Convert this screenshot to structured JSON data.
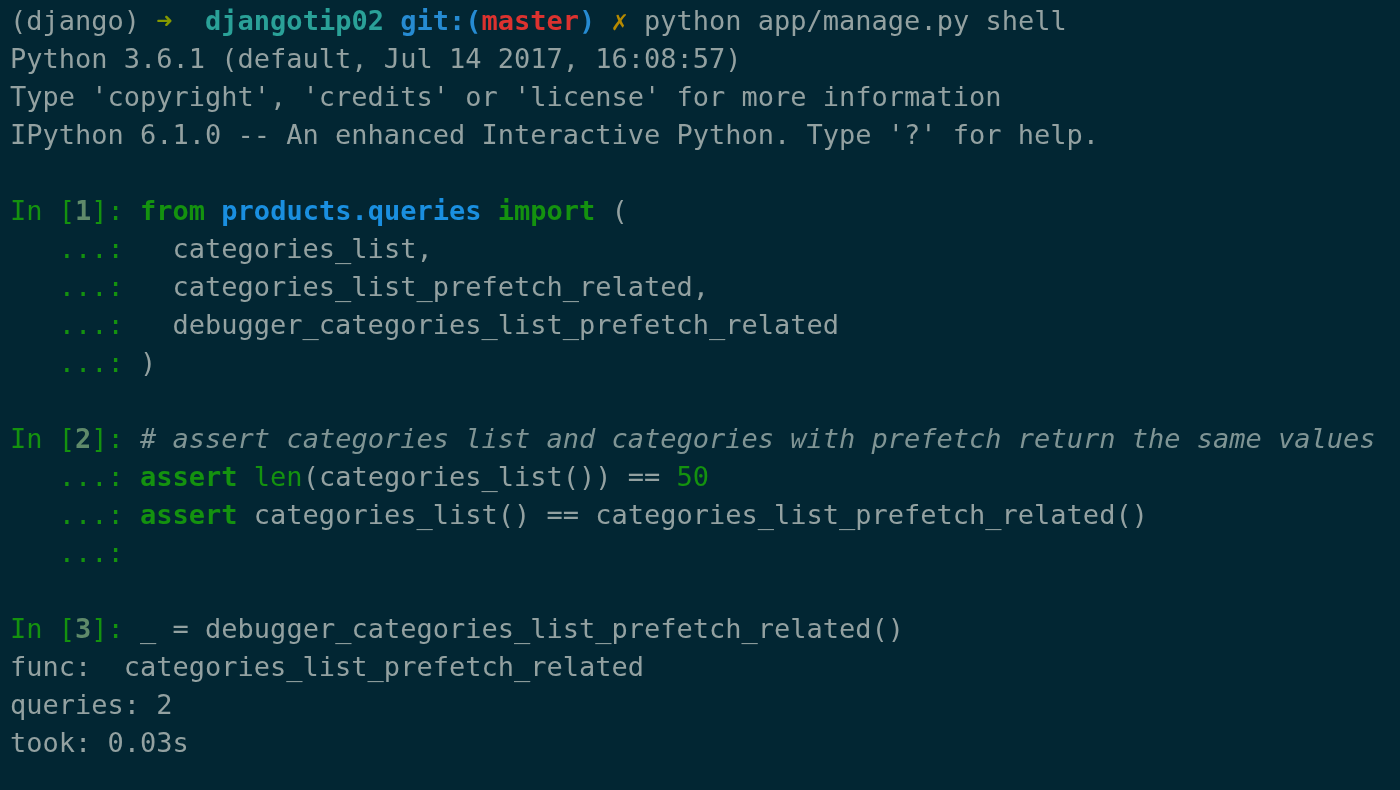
{
  "terminal": {
    "lines": [
      {
        "kind": "text",
        "segments": [
          {
            "kind": "plain",
            "text": "(django) "
          },
          {
            "kind": "arrow",
            "text": "➜  "
          },
          {
            "kind": "dir",
            "text": "djangotip02 "
          },
          {
            "kind": "git",
            "text": "git:("
          },
          {
            "kind": "branch",
            "text": "master"
          },
          {
            "kind": "git",
            "text": ") "
          },
          {
            "kind": "dirty",
            "text": "✗"
          },
          {
            "kind": "plain",
            "text": " python app/manage.py shell"
          }
        ]
      },
      {
        "kind": "text",
        "segments": [
          {
            "kind": "plain",
            "text": "Python 3.6.1 (default, Jul 14 2017, 16:08:57)"
          }
        ]
      },
      {
        "kind": "text",
        "segments": [
          {
            "kind": "plain",
            "text": "Type 'copyright', 'credits' or 'license' for more information"
          }
        ]
      },
      {
        "kind": "text",
        "segments": [
          {
            "kind": "plain",
            "text": "IPython 6.1.0 -- An enhanced Interactive Python. Type '?' for help."
          }
        ]
      },
      {
        "kind": "blank"
      },
      {
        "kind": "text",
        "segments": [
          {
            "kind": "prompt",
            "text": "In ["
          },
          {
            "kind": "prompt-num",
            "text": "1"
          },
          {
            "kind": "prompt",
            "text": "]: "
          },
          {
            "kind": "keyword",
            "text": "from "
          },
          {
            "kind": "module",
            "text": "products.queries "
          },
          {
            "kind": "keyword",
            "text": "import"
          },
          {
            "kind": "plain",
            "text": " ("
          }
        ]
      },
      {
        "kind": "text",
        "segments": [
          {
            "kind": "continuation",
            "text": "   ...: "
          },
          {
            "kind": "plain",
            "text": "  categories_list,"
          }
        ]
      },
      {
        "kind": "text",
        "segments": [
          {
            "kind": "continuation",
            "text": "   ...: "
          },
          {
            "kind": "plain",
            "text": "  categories_list_prefetch_related,"
          }
        ]
      },
      {
        "kind": "text",
        "segments": [
          {
            "kind": "continuation",
            "text": "   ...: "
          },
          {
            "kind": "plain",
            "text": "  debugger_categories_list_prefetch_related"
          }
        ]
      },
      {
        "kind": "text",
        "segments": [
          {
            "kind": "continuation",
            "text": "   ...: "
          },
          {
            "kind": "plain",
            "text": ")"
          }
        ]
      },
      {
        "kind": "blank"
      },
      {
        "kind": "text",
        "segments": [
          {
            "kind": "prompt",
            "text": "In ["
          },
          {
            "kind": "prompt-num",
            "text": "2"
          },
          {
            "kind": "prompt",
            "text": "]: "
          },
          {
            "kind": "comment",
            "text": "# assert categories list and categories with prefetch return the same values"
          }
        ]
      },
      {
        "kind": "text",
        "segments": [
          {
            "kind": "continuation",
            "text": "   ...: "
          },
          {
            "kind": "keyword",
            "text": "assert "
          },
          {
            "kind": "builtin",
            "text": "len"
          },
          {
            "kind": "plain",
            "text": "(categories_list()) == "
          },
          {
            "kind": "number",
            "text": "50"
          }
        ]
      },
      {
        "kind": "text",
        "segments": [
          {
            "kind": "continuation",
            "text": "   ...: "
          },
          {
            "kind": "keyword",
            "text": "assert"
          },
          {
            "kind": "plain",
            "text": " categories_list() == categories_list_prefetch_related()"
          }
        ]
      },
      {
        "kind": "text",
        "segments": [
          {
            "kind": "continuation",
            "text": "   ...:"
          }
        ]
      },
      {
        "kind": "blank"
      },
      {
        "kind": "text",
        "segments": [
          {
            "kind": "prompt",
            "text": "In ["
          },
          {
            "kind": "prompt-num",
            "text": "3"
          },
          {
            "kind": "prompt",
            "text": "]: "
          },
          {
            "kind": "plain",
            "text": "_ = debugger_categories_list_prefetch_related()"
          }
        ]
      },
      {
        "kind": "text",
        "segments": [
          {
            "kind": "plain",
            "text": "func:  categories_list_prefetch_related"
          }
        ]
      },
      {
        "kind": "text",
        "segments": [
          {
            "kind": "plain",
            "text": "queries: 2"
          }
        ]
      },
      {
        "kind": "text",
        "segments": [
          {
            "kind": "plain",
            "text": "took: 0.03s"
          }
        ]
      }
    ]
  }
}
